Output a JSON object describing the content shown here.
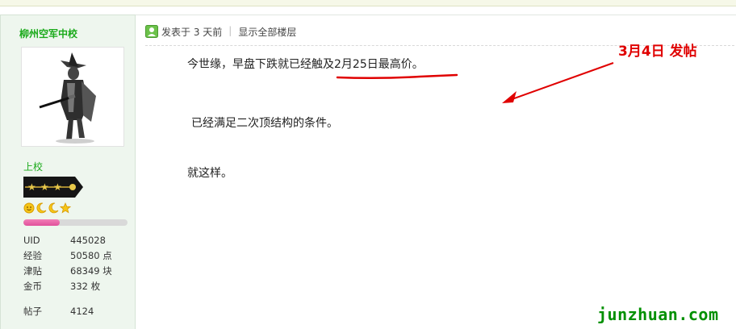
{
  "user": {
    "name": "柳州空军中校",
    "rank": "上校",
    "credit_progress": 0.35,
    "stats": [
      {
        "label": "UID",
        "value": "445028"
      },
      {
        "label": "经验",
        "value": "50580 点"
      },
      {
        "label": "津贴",
        "value": "68349 块"
      },
      {
        "label": "金币",
        "value": "332 枚"
      }
    ],
    "stats2": [
      {
        "label": "帖子",
        "value": "4124"
      }
    ]
  },
  "post": {
    "posted_at": "发表于 3 天前",
    "show_all": "显示全部楼层",
    "lines": {
      "l1": "今世缘，早盘下跌就已经触及2月25日最高价。",
      "l2": "已经满足二次顶结构的条件。",
      "l3": "就这样。"
    }
  },
  "annotation": "3月4日 发帖",
  "watermark": "junzhuan.com",
  "colors": {
    "username": "#1aaa1a",
    "annotation": "#e00000",
    "watermark": "#009000",
    "progress": "#e0509a"
  },
  "icons": {
    "online": "user-online-icon",
    "rank_badge": "military-rank-badge-icon"
  }
}
